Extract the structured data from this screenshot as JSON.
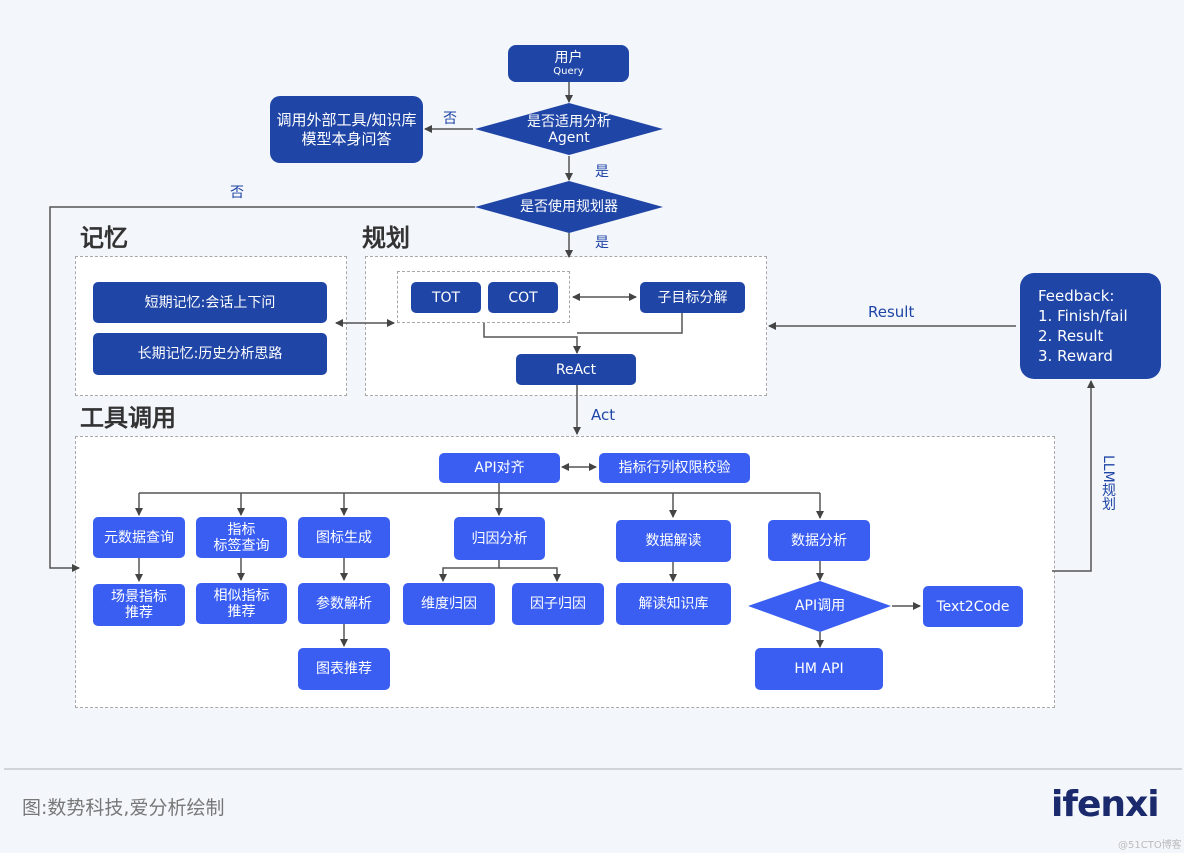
{
  "flow": {
    "user_query": {
      "title": "用户",
      "subtitle": "Query"
    },
    "decision_agent": {
      "line1": "是否适用分析",
      "line2": "Agent"
    },
    "external_tool": {
      "line1": "调用外部工具/知识库",
      "line2": "模型本身问答"
    },
    "decision_planner": "是否使用规划器",
    "label_no_1": "否",
    "label_yes_1": "是",
    "label_no_2": "否",
    "label_yes_2": "是",
    "label_result": "Result",
    "label_act": "Act",
    "label_llm": "LLM规划"
  },
  "memory": {
    "title": "记忆",
    "short_term": "短期记忆:会话上下问",
    "long_term": "长期记忆:历史分析思路"
  },
  "planning": {
    "title": "规划",
    "tot": "TOT",
    "cot": "COT",
    "subgoal": "子目标分解",
    "react": "ReAct"
  },
  "feedback": {
    "title": "Feedback:",
    "items": [
      "1. Finish/fail",
      "2. Result",
      "3. Reward"
    ]
  },
  "tools": {
    "title": "工具调用",
    "api_align": "API对齐",
    "permission_check": "指标行列权限校验",
    "metadata_query": "元数据查询",
    "scene_metric": {
      "line1": "场景指标",
      "line2": "推荐"
    },
    "metric_tag_query": {
      "line1": "指标",
      "line2": "标签查询"
    },
    "similar_metric": {
      "line1": "相似指标",
      "line2": "推荐"
    },
    "chart_gen": "图标生成",
    "param_parse": "参数解析",
    "chart_recommend": "图表推荐",
    "attribution": "归因分析",
    "dim_attribution": "维度归因",
    "factor_attribution": "因子归因",
    "data_interpret": "数据解读",
    "interpret_kb": "解读知识库",
    "data_analysis": "数据分析",
    "api_call": "API调用",
    "text2code": "Text2Code",
    "hm_api": "HM API"
  },
  "footer": {
    "caption": "图:数势科技,爱分析绘制",
    "logo": "ifenxi",
    "watermark": "@51CTO博客"
  }
}
